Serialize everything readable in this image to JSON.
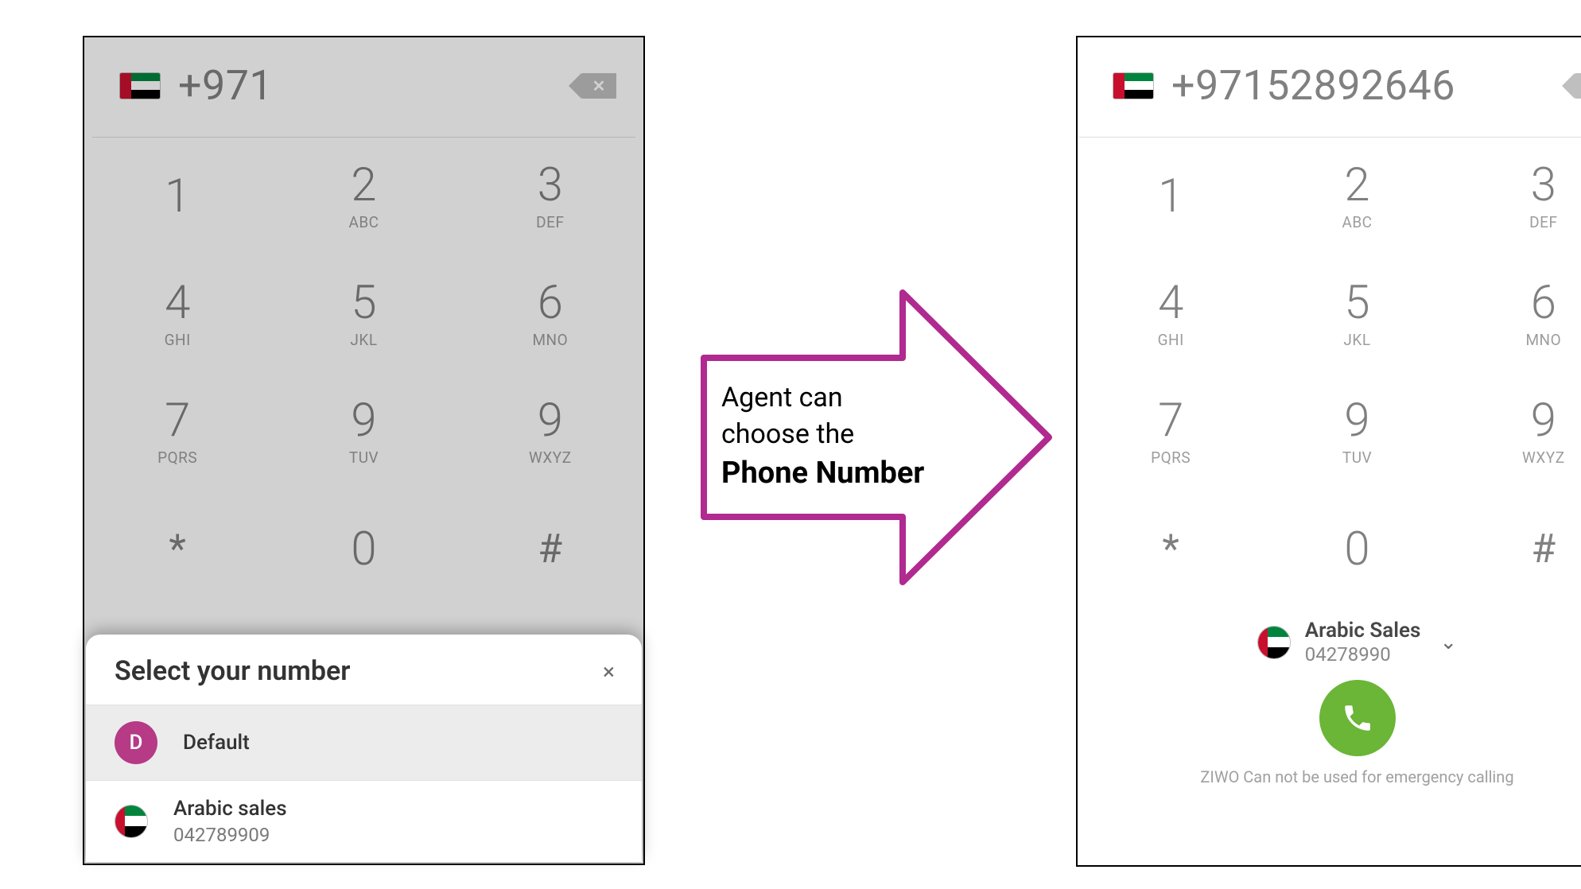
{
  "left": {
    "number": "+971"
  },
  "right": {
    "number": "+97152892646"
  },
  "keypad": [
    {
      "digit": "1",
      "letters": ""
    },
    {
      "digit": "2",
      "letters": "ABC"
    },
    {
      "digit": "3",
      "letters": "DEF"
    },
    {
      "digit": "4",
      "letters": "GHI"
    },
    {
      "digit": "5",
      "letters": "JKL"
    },
    {
      "digit": "6",
      "letters": "MNO"
    },
    {
      "digit": "7",
      "letters": "PQRS"
    },
    {
      "digit": "9",
      "letters": "TUV"
    },
    {
      "digit": "9",
      "letters": "WXYZ"
    },
    {
      "digit": "*",
      "letters": ""
    },
    {
      "digit": "0",
      "letters": ""
    },
    {
      "digit": "#",
      "letters": ""
    }
  ],
  "sheet": {
    "title": "Select your number",
    "options": [
      {
        "initials": "D",
        "title": "Default",
        "sub": ""
      },
      {
        "initials": "",
        "title": "Arabic sales",
        "sub": "042789909"
      }
    ]
  },
  "selected": {
    "title": "Arabic Sales",
    "sub": "04278990"
  },
  "note": "ZIWO Can not be used for emergency calling",
  "annotation": {
    "line1": "Agent can",
    "line2": "choose the",
    "line3": "Phone Number"
  }
}
